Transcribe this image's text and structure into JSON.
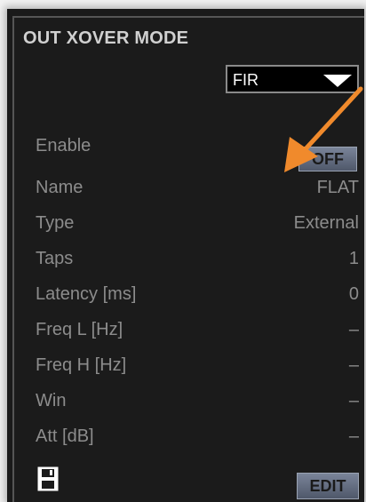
{
  "panel": {
    "title": "OUT XOVER MODE",
    "mode_select": {
      "value": "FIR"
    },
    "rows": [
      {
        "label": "Enable",
        "value": "OFF"
      },
      {
        "label": "Name",
        "value": "FLAT"
      },
      {
        "label": "Type",
        "value": "External"
      },
      {
        "label": "Taps",
        "value": "1"
      },
      {
        "label": "Latency [ms]",
        "value": "0"
      },
      {
        "label": "Freq L [Hz]",
        "value": "–"
      },
      {
        "label": "Freq H [Hz]",
        "value": "–"
      },
      {
        "label": "Win",
        "value": "–"
      },
      {
        "label": "Att [dB]",
        "value": "–"
      }
    ],
    "edit_label": "EDIT"
  },
  "icons": {
    "save": "floppy-disk-icon",
    "dropdown_arrow": "chevron-down-icon",
    "annotation": "arrow-pointer-annotation"
  },
  "colors": {
    "panel_bg": "#1b1b1b",
    "label_text": "#8c8c8c",
    "title_text": "#d0d0d0",
    "button_top": "#7a8499",
    "button_bottom": "#4f586a",
    "annotation_arrow": "#f08a2c"
  }
}
